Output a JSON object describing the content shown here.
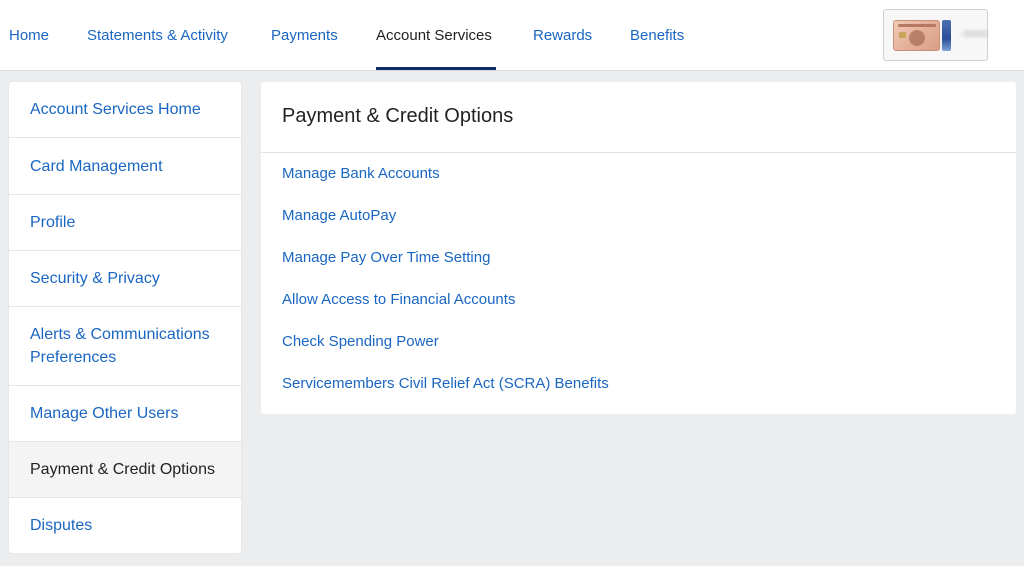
{
  "nav": {
    "tabs": [
      {
        "label": "Home"
      },
      {
        "label": "Statements & Activity"
      },
      {
        "label": "Payments"
      },
      {
        "label": "Account Services"
      },
      {
        "label": "Rewards"
      },
      {
        "label": "Benefits"
      }
    ],
    "active_tab": "Account Services",
    "card_digits": "-0000"
  },
  "sidebar": {
    "items": [
      {
        "label": "Account Services Home"
      },
      {
        "label": "Card Management"
      },
      {
        "label": "Profile"
      },
      {
        "label": "Security & Privacy"
      },
      {
        "label": "Alerts & Communications Preferences"
      },
      {
        "label": "Manage Other Users"
      },
      {
        "label": "Payment & Credit Options"
      },
      {
        "label": "Disputes"
      }
    ],
    "active_item": "Payment & Credit Options"
  },
  "main": {
    "title": "Payment & Credit Options",
    "links": [
      {
        "label": "Manage Bank Accounts"
      },
      {
        "label": "Manage AutoPay"
      },
      {
        "label": "Manage Pay Over Time Setting"
      },
      {
        "label": "Allow Access to Financial Accounts"
      },
      {
        "label": "Check Spending Power"
      },
      {
        "label": "Servicemembers Civil Relief Act (SCRA) Benefits"
      }
    ]
  },
  "colors": {
    "link": "#1a66c2",
    "active_underline": "#0b2d6b",
    "page_background": "#ecedee"
  }
}
